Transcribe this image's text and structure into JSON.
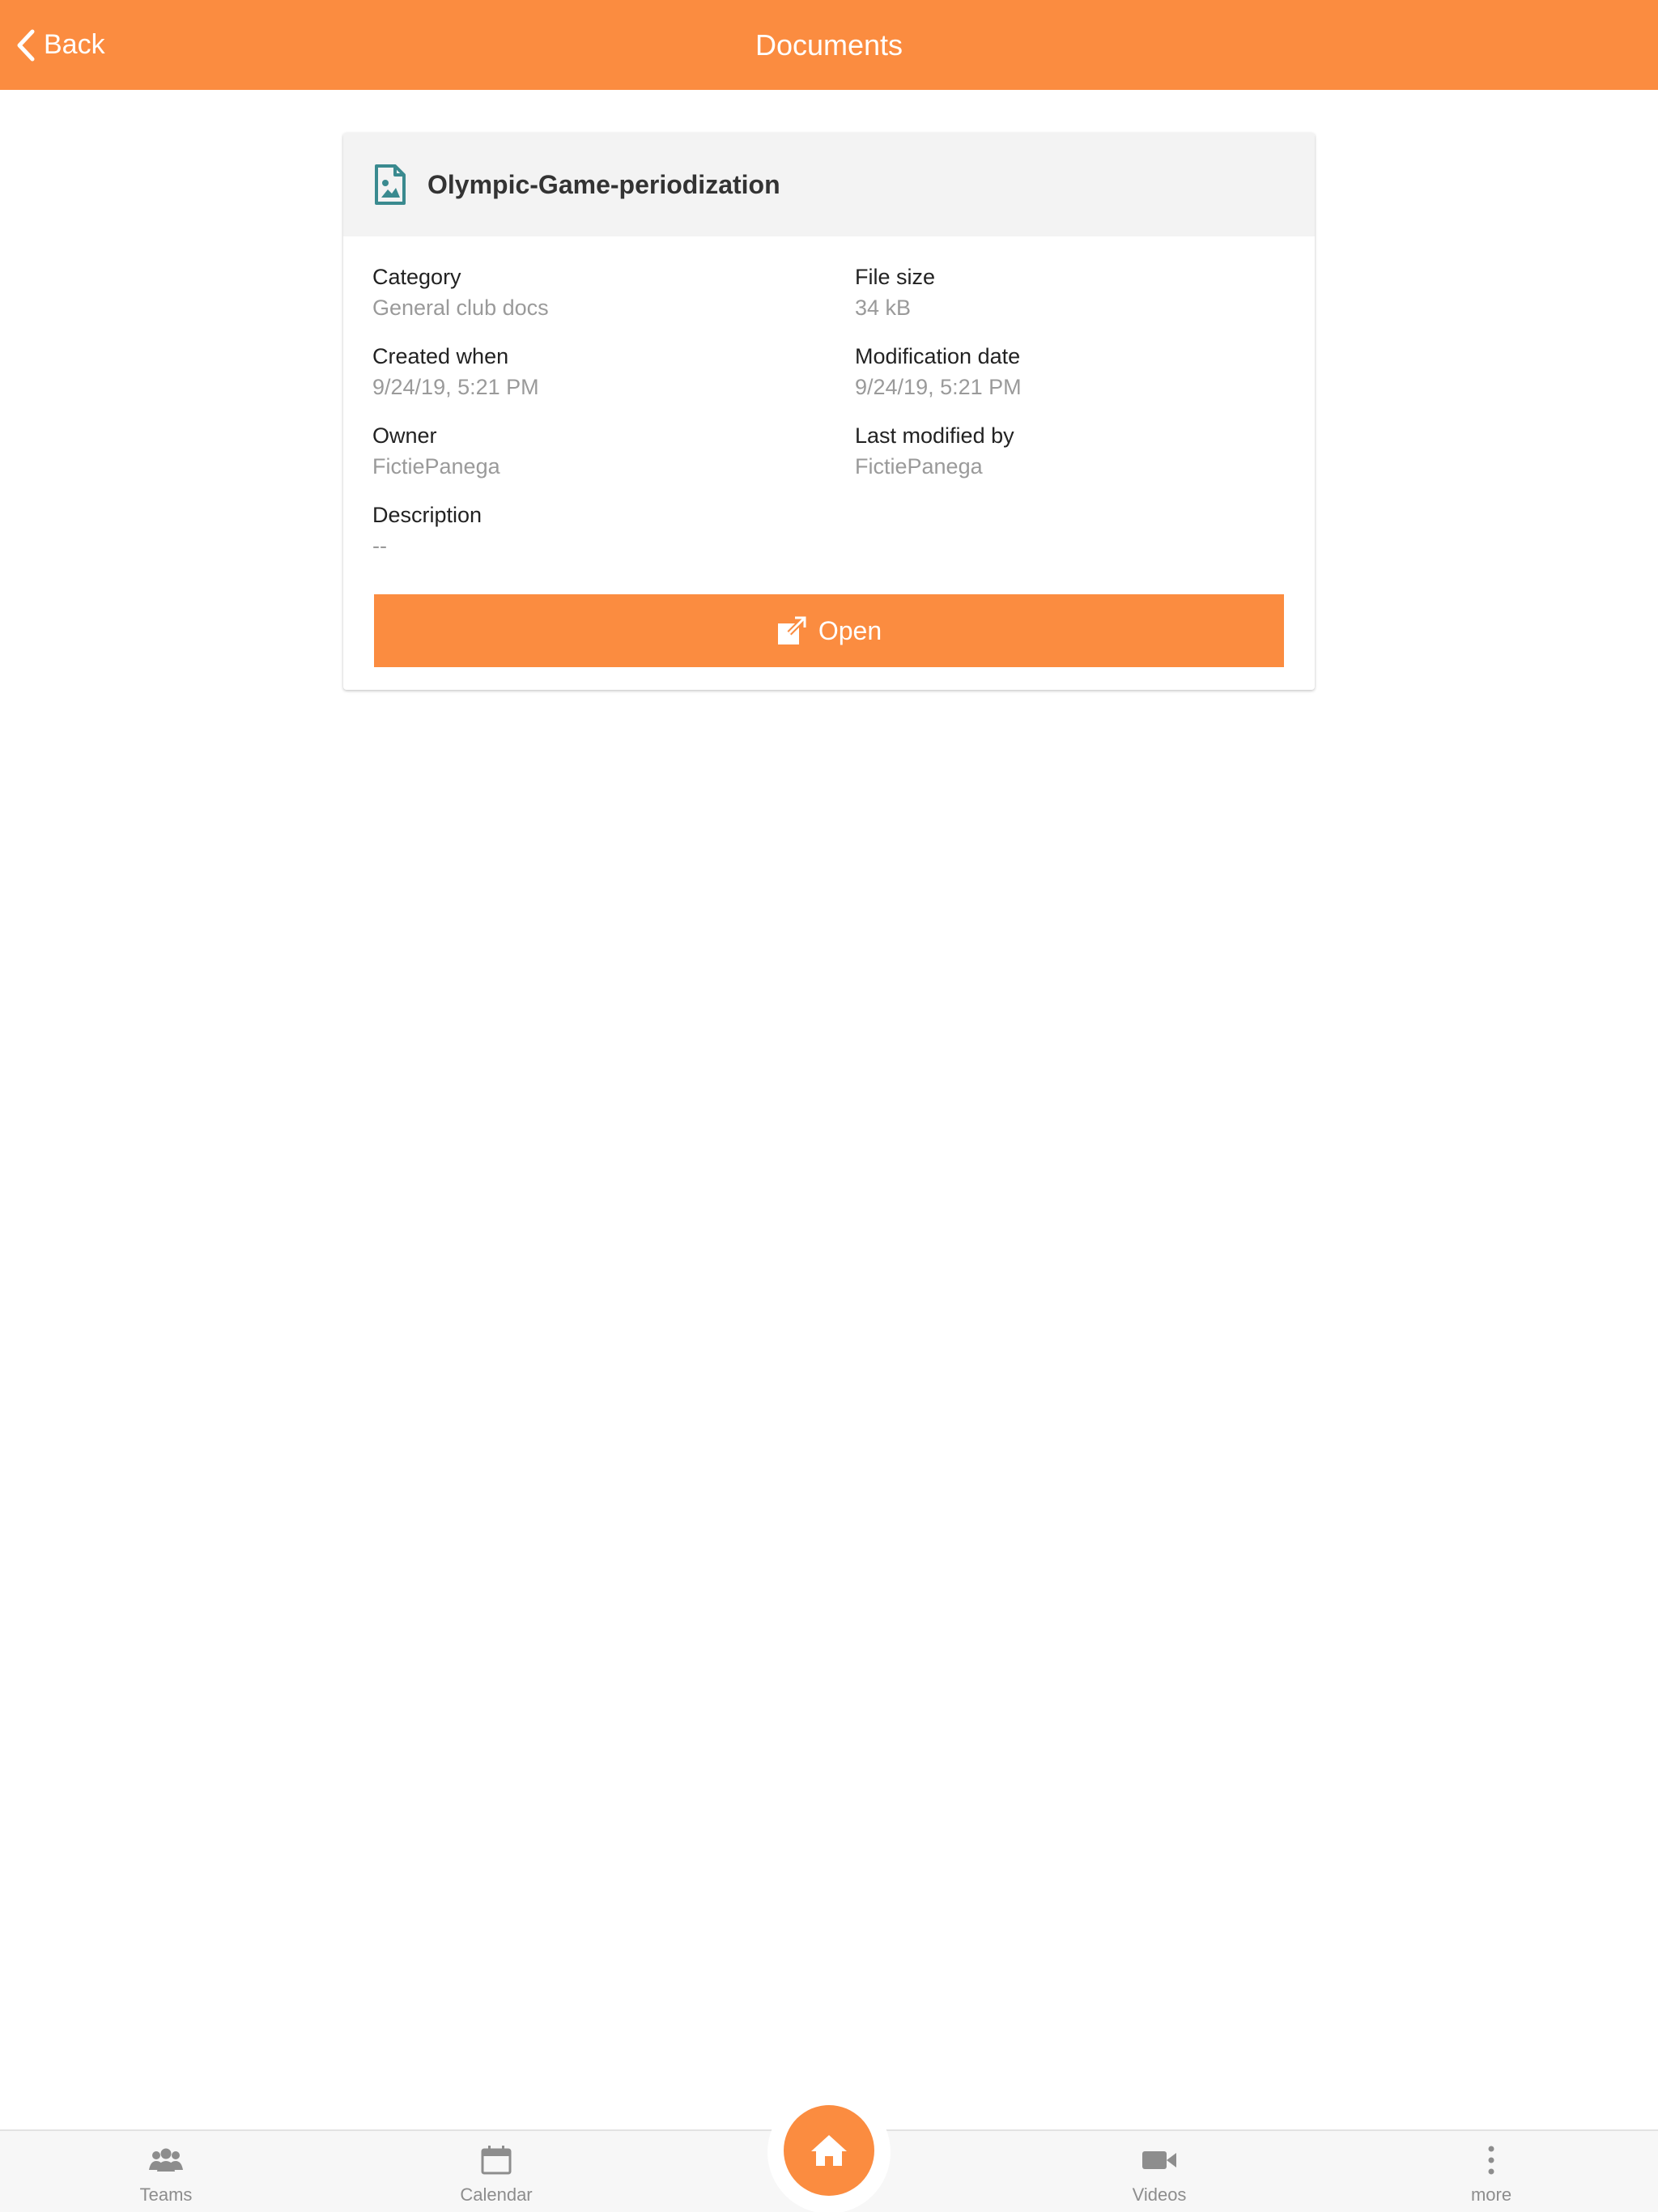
{
  "header": {
    "back_label": "Back",
    "title": "Documents",
    "background_color": "#fb8c40"
  },
  "document": {
    "icon": "image-file-icon",
    "title": "Olympic-Game-periodization",
    "fields": {
      "category": {
        "label": "Category",
        "value": "General club docs"
      },
      "file_size": {
        "label": "File size",
        "value": "34 kB"
      },
      "created_when": {
        "label": "Created when",
        "value": "9/24/19, 5:21 PM"
      },
      "modification_date": {
        "label": "Modification date",
        "value": "9/24/19, 5:21 PM"
      },
      "owner": {
        "label": "Owner",
        "value": "FictiePanega"
      },
      "last_modified_by": {
        "label": "Last modified by",
        "value": "FictiePanega"
      },
      "description": {
        "label": "Description",
        "value": "--"
      }
    },
    "open_button": {
      "icon": "external-link-icon",
      "label": "Open"
    }
  },
  "bottom_nav": {
    "items": [
      {
        "icon": "teams-icon",
        "label": "Teams"
      },
      {
        "icon": "calendar-icon",
        "label": "Calendar"
      },
      {
        "icon": "home-icon",
        "label": ""
      },
      {
        "icon": "video-camera-icon",
        "label": "Videos"
      },
      {
        "icon": "more-vertical-icon",
        "label": "more"
      }
    ]
  },
  "colors": {
    "accent": "#fb8c40",
    "icon_teal": "#3a8a8f",
    "muted_text": "#9a9a9a",
    "nav_icon": "#8d8d8d"
  }
}
